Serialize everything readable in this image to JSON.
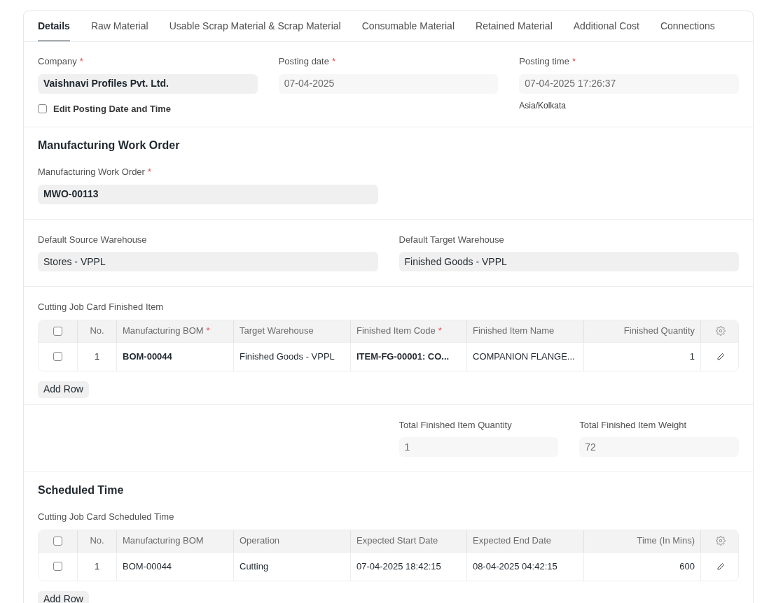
{
  "tabs": [
    {
      "label": "Details",
      "selected": true
    },
    {
      "label": "Raw Material",
      "selected": false
    },
    {
      "label": "Usable Scrap Material & Scrap Material",
      "selected": false
    },
    {
      "label": "Consumable Material",
      "selected": false
    },
    {
      "label": "Retained Material",
      "selected": false
    },
    {
      "label": "Additional Cost",
      "selected": false
    },
    {
      "label": "Connections",
      "selected": false
    }
  ],
  "posting": {
    "fields": [
      {
        "label": "Company",
        "required_mark": "*",
        "value": "Vaishnavi Profiles Pvt. Ltd.",
        "readonly": false,
        "bold": true
      },
      {
        "label": "Posting date",
        "required_mark": "*",
        "value": "07-04-2025",
        "readonly": true,
        "bold": false
      },
      {
        "label": "Posting time",
        "required_mark": "*",
        "value": "07-04-2025 17:26:37",
        "readonly": true,
        "bold": false,
        "hint": "Asia/Kolkata"
      }
    ],
    "checkbox": {
      "label": "Edit Posting Date and Time",
      "checked": false
    }
  },
  "work_order": {
    "title": "Manufacturing Work Order",
    "field": {
      "label": "Manufacturing Work Order",
      "required_mark": "*",
      "value": "MWO-00113",
      "readonly": false,
      "bold": true
    }
  },
  "warehouses": [
    {
      "label": "Default Source Warehouse",
      "value": "Stores - VPPL",
      "readonly": false,
      "bold": false
    },
    {
      "label": "Default Target Warehouse",
      "value": "Finished Goods - VPPL",
      "readonly": false,
      "bold": false
    }
  ],
  "finished_table": {
    "label": "Cutting Job Card Finished Item",
    "all_checked": false,
    "columns": [
      {
        "label": "No.",
        "kind": "index"
      },
      {
        "label": "Manufacturing BOM",
        "required_mark": "*",
        "kind": "bold"
      },
      {
        "label": "Target Warehouse",
        "kind": "text"
      },
      {
        "label": "Finished Item Code",
        "required_mark": "*",
        "kind": "bold"
      },
      {
        "label": "Finished Item Name",
        "kind": "text"
      },
      {
        "label": "Finished Quantity",
        "kind": "number"
      }
    ],
    "rows": [
      {
        "checked": false,
        "cells": [
          "1",
          "BOM-00044",
          "Finished Goods - VPPL",
          "ITEM-FG-00001: CO...",
          "COMPANION FLANGE...",
          "1"
        ]
      }
    ],
    "add_row": "Add Row"
  },
  "totals": [
    {
      "label": "Total Finished Item Quantity",
      "value": "1",
      "readonly": true,
      "bold": false
    },
    {
      "label": "Total Finished Item Weight",
      "value": "72",
      "readonly": true,
      "bold": false
    }
  ],
  "schedule": {
    "title": "Scheduled Time",
    "label": "Cutting Job Card Scheduled Time",
    "all_checked": false,
    "columns": [
      {
        "label": "No.",
        "kind": "index"
      },
      {
        "label": "Manufacturing BOM",
        "kind": "text"
      },
      {
        "label": "Operation",
        "kind": "text"
      },
      {
        "label": "Expected Start Date",
        "kind": "text"
      },
      {
        "label": "Expected End Date",
        "kind": "text"
      },
      {
        "label": "Time (In Mins)",
        "kind": "number"
      }
    ],
    "rows": [
      {
        "checked": false,
        "cells": [
          "1",
          "BOM-00044",
          "Cutting",
          "07-04-2025 18:42:15",
          "08-04-2025 04:42:15",
          "600"
        ]
      }
    ],
    "add_row": "Add Row"
  }
}
